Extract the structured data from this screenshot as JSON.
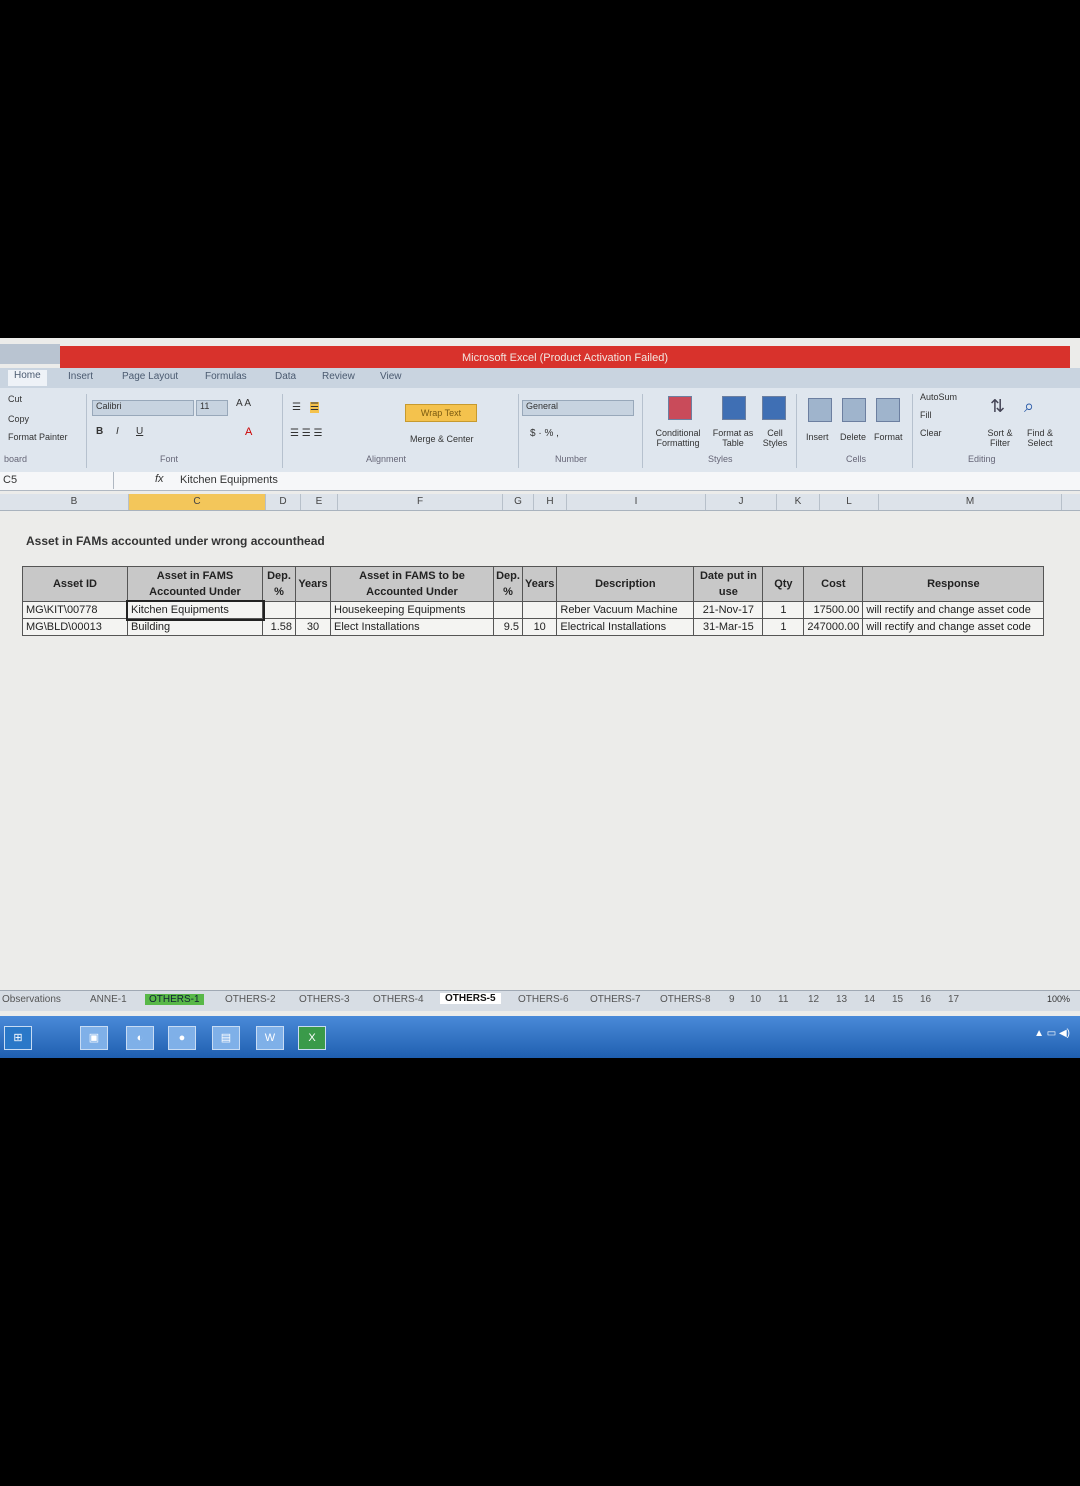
{
  "window": {
    "title": "Microsoft Excel (Product Activation Failed)"
  },
  "ribbon_tabs": [
    {
      "label": "Home"
    },
    {
      "label": "Insert"
    },
    {
      "label": "Page Layout"
    },
    {
      "label": "Formulas"
    },
    {
      "label": "Data"
    },
    {
      "label": "Review"
    },
    {
      "label": "View"
    }
  ],
  "ribbon": {
    "clipboard": {
      "cut": "Cut",
      "copy": "Copy",
      "format_painter": "Format Painter",
      "group": "board"
    },
    "font": {
      "name": "Calibri",
      "size": "11",
      "group": "Font"
    },
    "alignment": {
      "wrap_text": "Wrap Text",
      "merge_center": "Merge & Center",
      "group": "Alignment"
    },
    "number": {
      "format": "General",
      "group": "Number"
    },
    "styles": {
      "conditional": "Conditional Formatting",
      "format_table": "Format as Table",
      "cell_styles": "Cell Styles",
      "group": "Styles"
    },
    "cells": {
      "insert": "Insert",
      "delete": "Delete",
      "format": "Format",
      "group": "Cells"
    },
    "editing": {
      "autosum": "AutoSum",
      "fill": "Fill",
      "clear": "Clear",
      "sort_filter": "Sort & Filter",
      "find_select": "Find & Select",
      "group": "Editing"
    }
  },
  "formula_bar": {
    "name_box": "C5",
    "fx": "fx",
    "value": "Kitchen Equipments"
  },
  "columns": [
    "B",
    "C",
    "D",
    "E",
    "F",
    "G",
    "H",
    "I",
    "J",
    "K",
    "L",
    "M"
  ],
  "sheet": {
    "title": "Asset in FAMs accounted under wrong accounthead",
    "headers": [
      "Asset ID",
      "Asset in FAMS Accounted Under",
      "Dep. %",
      "Years",
      "Asset in FAMS to be Accounted Under",
      "Dep. %",
      "Years",
      "Description",
      "Date put in use",
      "Qty",
      "Cost",
      "Response"
    ],
    "rows": [
      [
        "MG\\KIT\\00778",
        "Kitchen Equipments",
        "",
        "",
        "Housekeeping Equipments",
        "",
        "",
        "Reber Vacuum Machine",
        "21-Nov-17",
        "1",
        "17500.00",
        "will rectify and change asset code"
      ],
      [
        "MG\\BLD\\00013",
        "Building",
        "1.58",
        "30",
        "Elect Installations",
        "9.5",
        "10",
        "Electrical Installations",
        "31-Mar-15",
        "1",
        "247000.00",
        "will rectify and change asset code"
      ]
    ]
  },
  "sheet_tabs": [
    {
      "label": "Observations"
    },
    {
      "label": "ANNE-1"
    },
    {
      "label": "OTHERS-1"
    },
    {
      "label": "OTHERS-2"
    },
    {
      "label": "OTHERS-3"
    },
    {
      "label": "OTHERS-4"
    },
    {
      "label": "OTHERS-5"
    },
    {
      "label": "OTHERS-6"
    },
    {
      "label": "OTHERS-7"
    },
    {
      "label": "OTHERS-8"
    },
    {
      "label": "9"
    },
    {
      "label": "10"
    },
    {
      "label": "11"
    },
    {
      "label": "12"
    },
    {
      "label": "13"
    },
    {
      "label": "14"
    },
    {
      "label": "15"
    },
    {
      "label": "16"
    },
    {
      "label": "17"
    }
  ],
  "status": {
    "zoom": "100%"
  }
}
